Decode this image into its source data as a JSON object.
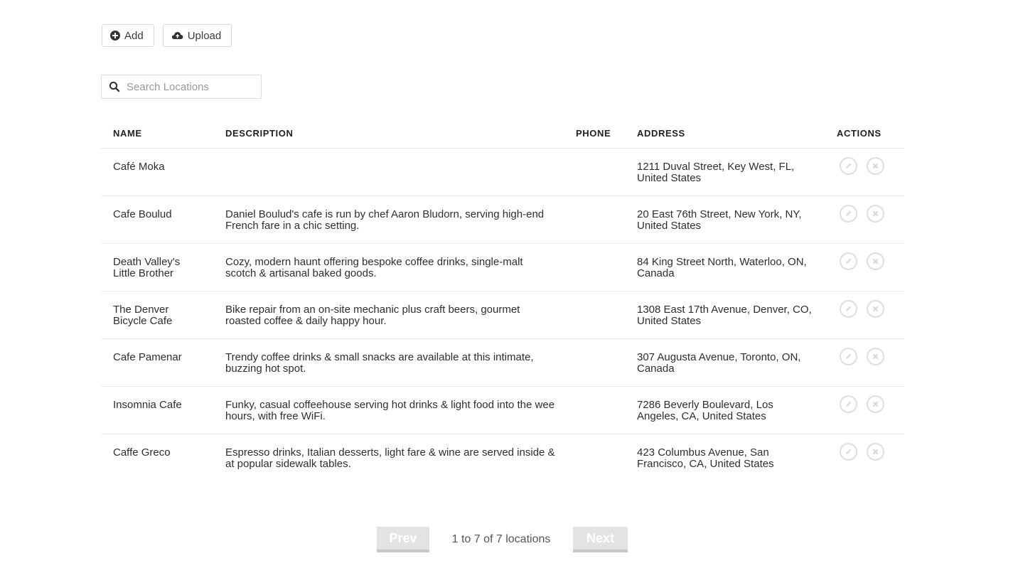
{
  "toolbar": {
    "add_label": "Add",
    "upload_label": "Upload"
  },
  "search": {
    "placeholder": "Search Locations",
    "value": ""
  },
  "table": {
    "headers": {
      "name": "NAME",
      "description": "DESCRIPTION",
      "phone": "PHONE",
      "address": "ADDRESS",
      "actions": "ACTIONS"
    },
    "rows": [
      {
        "name": "Café Moka",
        "description": "",
        "phone": "",
        "address": "1211 Duval Street, Key West, FL, United States"
      },
      {
        "name": "Cafe Boulud",
        "description": "Daniel Boulud's cafe is run by chef Aaron Bludorn, serving high-end French fare in a chic setting.",
        "phone": "",
        "address": "20 East 76th Street, New York, NY, United States"
      },
      {
        "name": "Death Valley's Little Brother",
        "description": "Cozy, modern haunt offering bespoke coffee drinks, single-malt scotch & artisanal baked goods.",
        "phone": "",
        "address": "84 King Street North, Waterloo, ON, Canada"
      },
      {
        "name": "The Denver Bicycle Cafe",
        "description": "Bike repair from an on-site mechanic plus craft beers, gourmet roasted coffee & daily happy hour.",
        "phone": "",
        "address": "1308 East 17th Avenue, Denver, CO, United States"
      },
      {
        "name": "Cafe Pamenar",
        "description": "Trendy coffee drinks & small snacks are available at this intimate, buzzing hot spot.",
        "phone": "",
        "address": "307 Augusta Avenue, Toronto, ON, Canada"
      },
      {
        "name": "Insomnia Cafe",
        "description": "Funky, casual coffeehouse serving hot drinks & light food into the wee hours, with free WiFi.",
        "phone": "",
        "address": "7286 Beverly Boulevard, Los Angeles, CA, United States"
      },
      {
        "name": "Caffe Greco",
        "description": "Espresso drinks, Italian desserts, light fare & wine are served inside & at popular sidewalk tables.",
        "phone": "",
        "address": "423 Columbus Avenue, San Francisco, CA, United States"
      }
    ]
  },
  "pagination": {
    "prev_label": "Prev",
    "info": "1 to 7 of 7 locations",
    "next_label": "Next"
  },
  "icons": {
    "add": "plus-circle-icon",
    "upload": "cloud-upload-icon",
    "search": "search-icon",
    "edit": "pencil-icon",
    "delete": "close-circle-icon"
  },
  "colors": {
    "action_icon": "#dedede",
    "pager_button": "#e3e3e3"
  }
}
